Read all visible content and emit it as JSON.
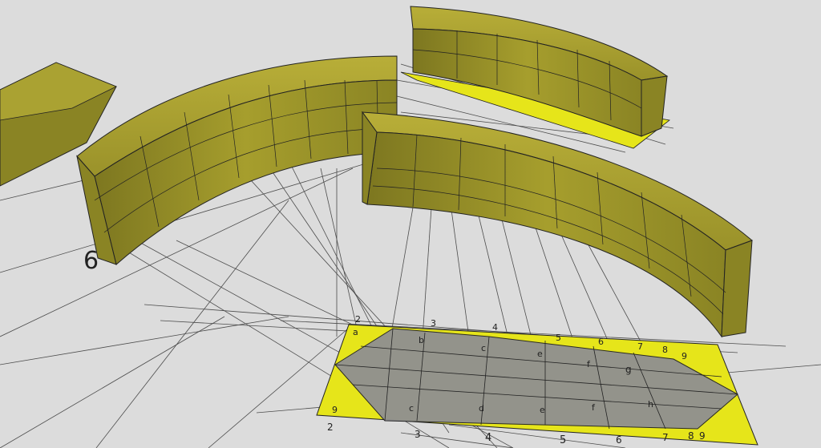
{
  "scene": {
    "background": "#dcdcdc",
    "solid_color": "#9c9527",
    "solid_dark": "#6f6a1c",
    "highlight_color": "#e6e51a",
    "shadow_color": "#8f8f92",
    "line_color": "#222222"
  },
  "labels": {
    "big_marker": "6",
    "near_left": "2",
    "c1": "c",
    "c2": "d",
    "c3": "e",
    "c4": "f",
    "c5": "g",
    "c6": "h",
    "top_a": "a",
    "top_b": "b",
    "top_c": "c",
    "top_3": "3",
    "top_4": "4",
    "top_5": "5",
    "top_6": "6",
    "top_7": "7",
    "top_8": "8",
    "top_9": "9",
    "bottom_2": "2",
    "bottom_3": "3",
    "bottom_4": "4",
    "bottom_5": "5",
    "bottom_6": "6",
    "bottom_7": "7",
    "bottom_8": "8",
    "bottom_9": "9",
    "left_9": "9"
  }
}
